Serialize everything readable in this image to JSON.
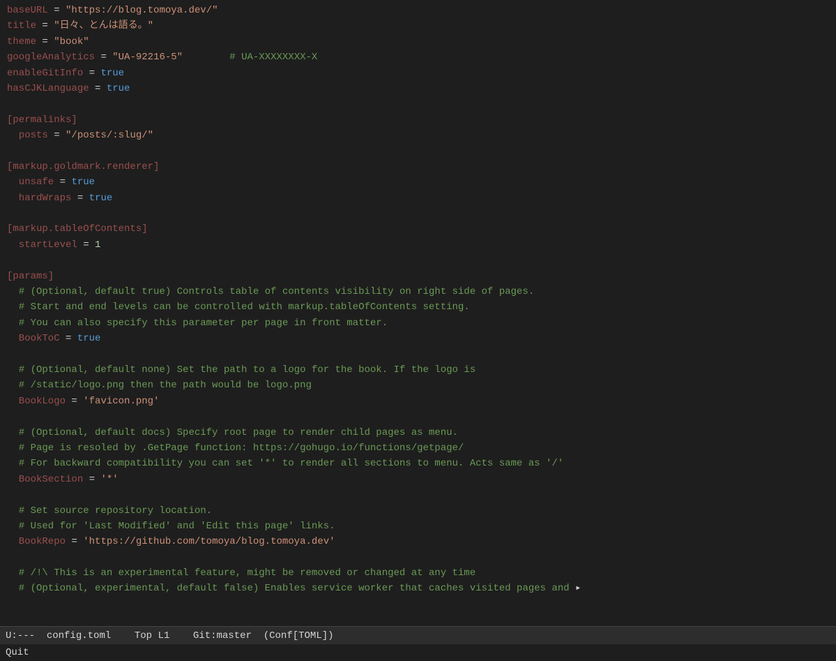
{
  "editor": {
    "lines": [
      {
        "tokens": [
          {
            "text": "baseURL",
            "class": "key"
          },
          {
            "text": " = ",
            "class": "plain"
          },
          {
            "text": "\"https://blog.tomoya.dev/\"",
            "class": "string"
          }
        ]
      },
      {
        "tokens": [
          {
            "text": "title",
            "class": "key"
          },
          {
            "text": " = ",
            "class": "plain"
          },
          {
            "text": "\"日々、とんは語る。\"",
            "class": "string"
          }
        ]
      },
      {
        "tokens": [
          {
            "text": "theme",
            "class": "key"
          },
          {
            "text": " = ",
            "class": "plain"
          },
          {
            "text": "\"book\"",
            "class": "string"
          }
        ]
      },
      {
        "tokens": [
          {
            "text": "googleAnalytics",
            "class": "key"
          },
          {
            "text": " = ",
            "class": "plain"
          },
          {
            "text": "\"UA-92216-5\"",
            "class": "string"
          },
          {
            "text": "        # UA-XXXXXXXX-X",
            "class": "comment"
          }
        ]
      },
      {
        "tokens": [
          {
            "text": "enableGitInfo",
            "class": "key"
          },
          {
            "text": " = ",
            "class": "plain"
          },
          {
            "text": "true",
            "class": "bool-true"
          }
        ]
      },
      {
        "tokens": [
          {
            "text": "hasCJKLanguage",
            "class": "key"
          },
          {
            "text": " = ",
            "class": "plain"
          },
          {
            "text": "true",
            "class": "bool-true"
          }
        ]
      },
      {
        "tokens": [
          {
            "text": "",
            "class": "plain"
          }
        ]
      },
      {
        "tokens": [
          {
            "text": "[permalinks]",
            "class": "section"
          }
        ]
      },
      {
        "tokens": [
          {
            "text": "  posts",
            "class": "key"
          },
          {
            "text": " = ",
            "class": "plain"
          },
          {
            "text": "\"/posts/:slug/\"",
            "class": "string"
          }
        ]
      },
      {
        "tokens": [
          {
            "text": "",
            "class": "plain"
          }
        ]
      },
      {
        "tokens": [
          {
            "text": "[markup.goldmark.renderer]",
            "class": "section"
          }
        ]
      },
      {
        "tokens": [
          {
            "text": "  unsafe",
            "class": "key"
          },
          {
            "text": " = ",
            "class": "plain"
          },
          {
            "text": "true",
            "class": "bool-true"
          }
        ]
      },
      {
        "tokens": [
          {
            "text": "  hardWraps",
            "class": "key"
          },
          {
            "text": " = ",
            "class": "plain"
          },
          {
            "text": "true",
            "class": "bool-true"
          }
        ]
      },
      {
        "tokens": [
          {
            "text": "",
            "class": "plain"
          }
        ]
      },
      {
        "tokens": [
          {
            "text": "[markup.tableOfContents]",
            "class": "section"
          }
        ]
      },
      {
        "tokens": [
          {
            "text": "  startLevel",
            "class": "key"
          },
          {
            "text": " = ",
            "class": "plain"
          },
          {
            "text": "1",
            "class": "number"
          }
        ]
      },
      {
        "tokens": [
          {
            "text": "",
            "class": "plain"
          }
        ]
      },
      {
        "tokens": [
          {
            "text": "[params]",
            "class": "section"
          }
        ]
      },
      {
        "tokens": [
          {
            "text": "  # (Optional, default true) Controls table of contents visibility on right side of pages.",
            "class": "comment"
          }
        ]
      },
      {
        "tokens": [
          {
            "text": "  # Start and end levels can be controlled with markup.tableOfContents setting.",
            "class": "comment"
          }
        ]
      },
      {
        "tokens": [
          {
            "text": "  # You can also specify this parameter per page in front matter.",
            "class": "comment"
          }
        ]
      },
      {
        "tokens": [
          {
            "text": "  BookToC",
            "class": "key"
          },
          {
            "text": " = ",
            "class": "plain"
          },
          {
            "text": "true",
            "class": "bool-true"
          }
        ]
      },
      {
        "tokens": [
          {
            "text": "",
            "class": "plain"
          }
        ]
      },
      {
        "tokens": [
          {
            "text": "  # (Optional, default none) Set the path to a logo for the book. If the logo is",
            "class": "comment"
          }
        ]
      },
      {
        "tokens": [
          {
            "text": "  # /static/logo.png then the path would be logo.png",
            "class": "comment"
          }
        ]
      },
      {
        "tokens": [
          {
            "text": "  BookLogo",
            "class": "key"
          },
          {
            "text": " = ",
            "class": "plain"
          },
          {
            "text": "'favicon.png'",
            "class": "string"
          }
        ]
      },
      {
        "tokens": [
          {
            "text": "",
            "class": "plain"
          }
        ]
      },
      {
        "tokens": [
          {
            "text": "  # (Optional, default docs) Specify root page to render child pages as menu.",
            "class": "comment"
          }
        ]
      },
      {
        "tokens": [
          {
            "text": "  # Page is resoled by .GetPage function: https://gohugo.io/functions/getpage/",
            "class": "comment"
          }
        ]
      },
      {
        "tokens": [
          {
            "text": "  # For backward compatibility you can set '*' to render all sections to menu. Acts same as '/'",
            "class": "comment"
          }
        ]
      },
      {
        "tokens": [
          {
            "text": "  BookSection",
            "class": "key"
          },
          {
            "text": " = ",
            "class": "plain"
          },
          {
            "text": "'*'",
            "class": "string"
          }
        ]
      },
      {
        "tokens": [
          {
            "text": "",
            "class": "plain"
          }
        ]
      },
      {
        "tokens": [
          {
            "text": "  # Set source repository location.",
            "class": "comment"
          }
        ]
      },
      {
        "tokens": [
          {
            "text": "  # Used for 'Last Modified' and 'Edit this page' links.",
            "class": "comment"
          }
        ]
      },
      {
        "tokens": [
          {
            "text": "  BookRepo",
            "class": "key"
          },
          {
            "text": " = ",
            "class": "plain"
          },
          {
            "text": "'https://github.com/tomoya/blog.tomoya.dev'",
            "class": "string"
          }
        ]
      },
      {
        "tokens": [
          {
            "text": "",
            "class": "plain"
          }
        ]
      },
      {
        "tokens": [
          {
            "text": "  # /!\\ This is an experimental feature, might be removed or changed at any time",
            "class": "comment"
          }
        ]
      },
      {
        "tokens": [
          {
            "text": "  # (Optional, experimental, default false) Enables service worker that caches visited pages and ",
            "class": "comment"
          },
          {
            "text": "▸",
            "class": "plain"
          }
        ]
      }
    ]
  },
  "status_bar": {
    "mode": "U:---",
    "filename": "config.toml",
    "position": "Top L1",
    "vcs": "Git:master",
    "filetype": "(Conf[TOML])"
  },
  "command_line": {
    "text": "Quit"
  }
}
